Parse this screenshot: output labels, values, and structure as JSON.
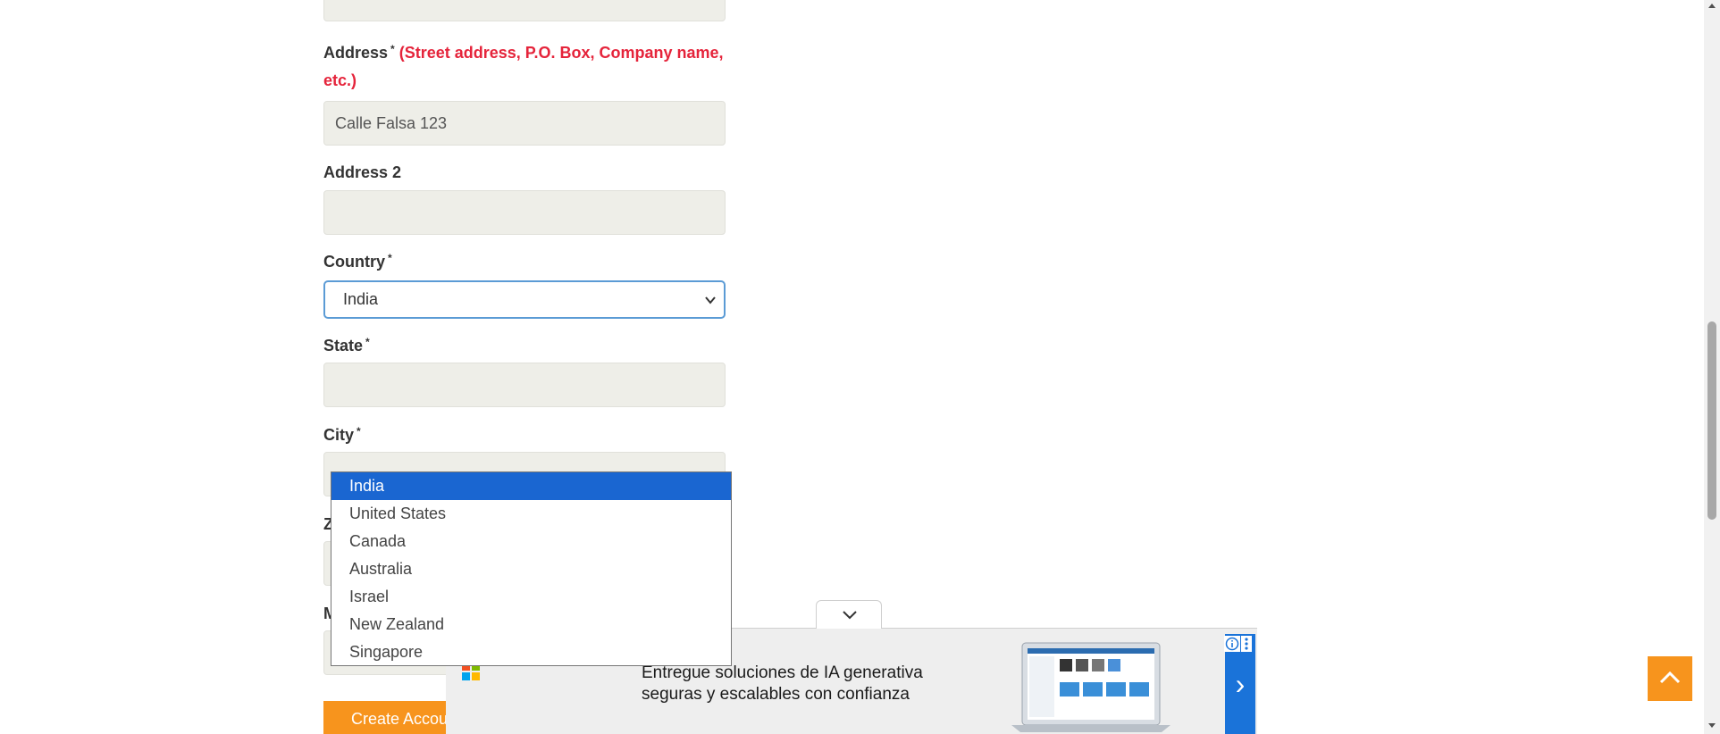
{
  "form": {
    "address": {
      "label": "Address",
      "required_mark": "*",
      "hint_line1": "(Street address, P.O. Box, Company name,",
      "hint_line2": "etc.)",
      "value": "Calle Falsa 123"
    },
    "address2": {
      "label": "Address 2",
      "value": ""
    },
    "country": {
      "label": "Country",
      "required_mark": "*",
      "selected": "India",
      "options": [
        "India",
        "United States",
        "Canada",
        "Australia",
        "Israel",
        "New Zealand",
        "Singapore"
      ]
    },
    "state": {
      "label": "State",
      "required_mark": "*",
      "value": ""
    },
    "city": {
      "label": "City",
      "required_mark": "*",
      "value": ""
    },
    "zip_partial_label": "Z",
    "mobile_partial_label": "M",
    "create_button": "Create Account"
  },
  "ad": {
    "headline_line1": "Entregue soluciones de IA generativa",
    "headline_line2": "seguras y escalables con confianza",
    "arrow": "›",
    "colors": {
      "accent": "#1a73d9",
      "background": "#eeeeee"
    }
  },
  "icons": {
    "select_chevron": "chevron-down-icon",
    "ad_collapse": "chevron-down-icon",
    "back_to_top": "chevron-up-icon",
    "ad_info": "info-icon",
    "ad_menu": "kebab-menu-icon"
  },
  "colors": {
    "accent_orange": "#f7941d",
    "hint_red": "#e5243b",
    "dropdown_highlight": "#1a66d1",
    "field_bg": "#eeeee8",
    "focus_border": "#5b9bd5"
  }
}
